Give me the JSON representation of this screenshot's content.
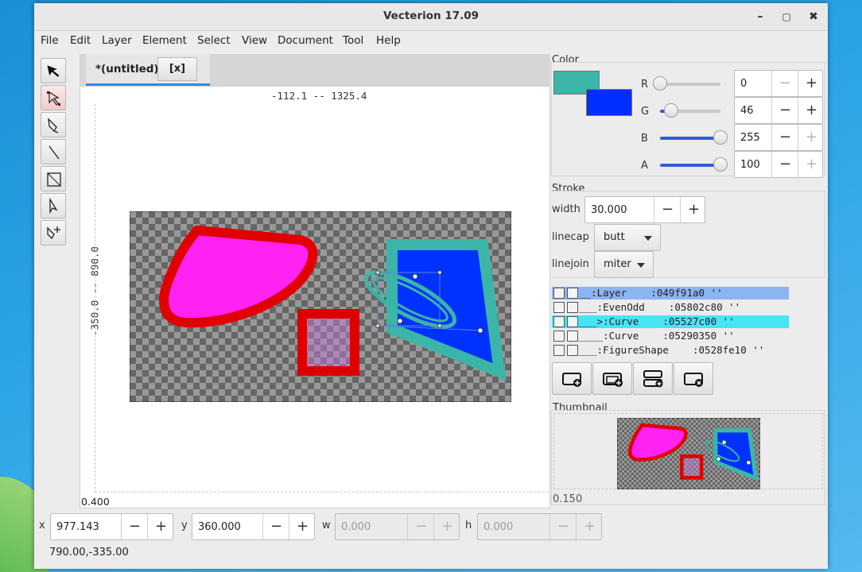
{
  "window": {
    "title": "Vecterion 17.09"
  },
  "window_controls": {
    "minimize": "–",
    "maximize": "▢",
    "close": "✖"
  },
  "menu": [
    "File",
    "Edit",
    "Layer",
    "Element",
    "Select",
    "View",
    "Document",
    "Tool",
    "Help"
  ],
  "tools": [
    "select-arrow-icon",
    "node-select-icon",
    "pen-tool-icon",
    "line-tool-icon",
    "rectangle-tool-icon",
    "knife-tool-icon",
    "add-anchor-icon"
  ],
  "document_tab": {
    "title": "*(untitled)",
    "close_label": "[x]"
  },
  "canvas": {
    "ruler_x": "-112.1 -- 1325.4",
    "ruler_y": "-350.0 -- 890.0",
    "zoom": "0.400"
  },
  "coordinates": {
    "x_label": "x",
    "x_value": "977.143",
    "y_label": "y",
    "y_value": "360.000",
    "w_label": "w",
    "w_value": "0.000",
    "h_label": "h",
    "h_value": "0.000"
  },
  "status": {
    "cursor": "790.00,-335.00"
  },
  "color_panel": {
    "title": "Color",
    "primary_color": "#3bb5a7",
    "secondary_color": "#002eff",
    "channels": [
      {
        "label": "R",
        "value": "0",
        "level": 0
      },
      {
        "label": "G",
        "value": "46",
        "level": 0.18
      },
      {
        "label": "B",
        "value": "255",
        "level": 1.0
      },
      {
        "label": "A",
        "value": "100",
        "level": 1.0
      }
    ]
  },
  "stroke_panel": {
    "title": "Stroke",
    "width_label": "width",
    "width_value": "30.000",
    "linecap_label": "linecap",
    "linecap_value": "butt",
    "linejoin_label": "linejoin",
    "linejoin_value": "miter"
  },
  "layers": [
    {
      "text": "__:Layer    :049f91a0 ''",
      "state": "selected-layer"
    },
    {
      "text": "___:EvenOdd    :05802c80 ''",
      "state": "normal"
    },
    {
      "text": "___>:Curve    :05527c00 ''",
      "state": "selected-element"
    },
    {
      "text": "____:Curve    :05290350 ''",
      "state": "normal"
    },
    {
      "text": "___:FigureShape    :0528fe10 ''",
      "state": "normal"
    }
  ],
  "layer_actions": [
    "add-element-icon",
    "add-layer-icon",
    "add-child-layer-icon",
    "delete-element-icon"
  ],
  "thumbnail": {
    "title": "Thumbnail",
    "zoom": "0.150"
  },
  "plus_minus": {
    "minus": "−",
    "plus": "+"
  }
}
